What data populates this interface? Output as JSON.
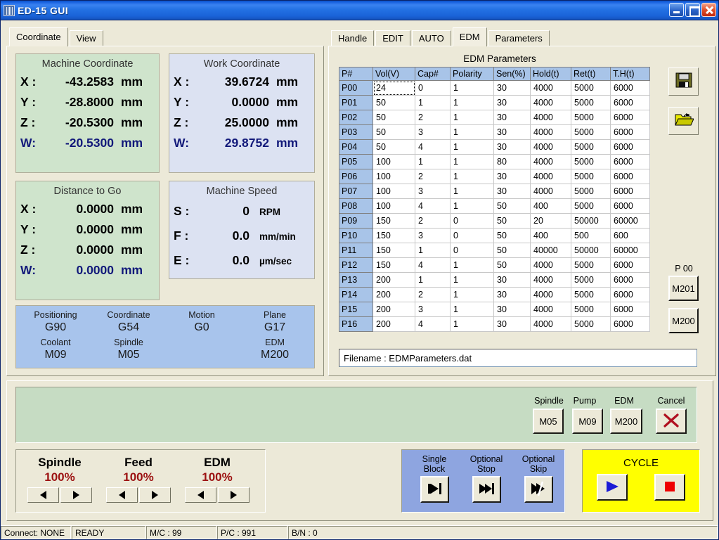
{
  "window": {
    "title": "ED-15 GUI",
    "minimize_label": "Minimize",
    "maximize_label": "Maximize",
    "close_label": "Close"
  },
  "left_tabs": [
    {
      "label": "Coordinate",
      "active": true
    },
    {
      "label": "View",
      "active": false
    }
  ],
  "machine_coordinate": {
    "caption": "Machine Coordinate",
    "rows": [
      {
        "axis": "X :",
        "value": "-43.2583",
        "unit": "mm"
      },
      {
        "axis": "Y :",
        "value": "-28.8000",
        "unit": "mm"
      },
      {
        "axis": "Z :",
        "value": "-20.5300",
        "unit": "mm"
      },
      {
        "axis": "W:",
        "value": "-20.5300",
        "unit": "mm"
      }
    ]
  },
  "work_coordinate": {
    "caption": "Work Coordinate",
    "rows": [
      {
        "axis": "X :",
        "value": "39.6724",
        "unit": "mm"
      },
      {
        "axis": "Y :",
        "value": "0.0000",
        "unit": "mm"
      },
      {
        "axis": "Z :",
        "value": "25.0000",
        "unit": "mm"
      },
      {
        "axis": "W:",
        "value": "29.8752",
        "unit": "mm"
      }
    ]
  },
  "distance_to_go": {
    "caption": "Distance to Go",
    "rows": [
      {
        "axis": "X :",
        "value": "0.0000",
        "unit": "mm"
      },
      {
        "axis": "Y :",
        "value": "0.0000",
        "unit": "mm"
      },
      {
        "axis": "Z :",
        "value": "0.0000",
        "unit": "mm"
      },
      {
        "axis": "W:",
        "value": "0.0000",
        "unit": "mm"
      }
    ]
  },
  "machine_speed": {
    "caption": "Machine Speed",
    "rows": [
      {
        "axis": "S :",
        "value": "0",
        "unit": "RPM"
      },
      {
        "axis": "F :",
        "value": "0.0",
        "unit": "mm/min"
      },
      {
        "axis": "E :",
        "value": "0.0",
        "unit": "µm/sec"
      }
    ]
  },
  "gcode_status": {
    "row1": [
      {
        "title": "Positioning",
        "value": "G90"
      },
      {
        "title": "Coordinate",
        "value": "G54"
      },
      {
        "title": "Motion",
        "value": "G0"
      },
      {
        "title": "Plane",
        "value": "G17"
      }
    ],
    "row2": [
      {
        "title": "Coolant",
        "value": "M09"
      },
      {
        "title": "Spindle",
        "value": "M05"
      },
      {
        "title": "",
        "value": ""
      },
      {
        "title": "EDM",
        "value": "M200"
      }
    ]
  },
  "right_tabs": [
    {
      "label": "Handle",
      "active": false
    },
    {
      "label": "EDIT",
      "active": false
    },
    {
      "label": "AUTO",
      "active": false
    },
    {
      "label": "EDM",
      "active": true
    },
    {
      "label": "Parameters",
      "active": false
    }
  ],
  "edm": {
    "title": "EDM Parameters",
    "columns": [
      "P#",
      "Vol(V)",
      "Cap#",
      "Polarity",
      "Sen(%)",
      "Hold(t)",
      "Ret(t)",
      "T.H(t)"
    ],
    "rows": [
      [
        "P00",
        "24",
        "0",
        "1",
        "30",
        "4000",
        "5000",
        "6000"
      ],
      [
        "P01",
        "50",
        "1",
        "1",
        "30",
        "4000",
        "5000",
        "6000"
      ],
      [
        "P02",
        "50",
        "2",
        "1",
        "30",
        "4000",
        "5000",
        "6000"
      ],
      [
        "P03",
        "50",
        "3",
        "1",
        "30",
        "4000",
        "5000",
        "6000"
      ],
      [
        "P04",
        "50",
        "4",
        "1",
        "30",
        "4000",
        "5000",
        "6000"
      ],
      [
        "P05",
        "100",
        "1",
        "1",
        "80",
        "4000",
        "5000",
        "6000"
      ],
      [
        "P06",
        "100",
        "2",
        "1",
        "30",
        "4000",
        "5000",
        "6000"
      ],
      [
        "P07",
        "100",
        "3",
        "1",
        "30",
        "4000",
        "5000",
        "6000"
      ],
      [
        "P08",
        "100",
        "4",
        "1",
        "50",
        "400",
        "5000",
        "6000"
      ],
      [
        "P09",
        "150",
        "2",
        "0",
        "50",
        "20",
        "50000",
        "60000"
      ],
      [
        "P10",
        "150",
        "3",
        "0",
        "50",
        "400",
        "500",
        "600"
      ],
      [
        "P11",
        "150",
        "1",
        "0",
        "50",
        "40000",
        "50000",
        "60000"
      ],
      [
        "P12",
        "150",
        "4",
        "1",
        "50",
        "4000",
        "5000",
        "6000"
      ],
      [
        "P13",
        "200",
        "1",
        "1",
        "30",
        "4000",
        "5000",
        "6000"
      ],
      [
        "P14",
        "200",
        "2",
        "1",
        "30",
        "4000",
        "5000",
        "6000"
      ],
      [
        "P15",
        "200",
        "3",
        "1",
        "30",
        "4000",
        "5000",
        "6000"
      ],
      [
        "P16",
        "200",
        "4",
        "1",
        "30",
        "4000",
        "5000",
        "6000"
      ]
    ],
    "focused_cell": {
      "row": 0,
      "col": 1
    },
    "filename_label": "Filename : EDMParameters.dat",
    "save_icon": "floppy-disk-icon",
    "open_icon": "open-folder-icon",
    "program_label": "P 00",
    "m201_label": "M201",
    "m200_label": "M200"
  },
  "mcodes": [
    {
      "title": "Spindle",
      "value": "M05"
    },
    {
      "title": "Pump",
      "value": "M09"
    },
    {
      "title": "EDM",
      "value": "M200"
    },
    {
      "title": "Cancel",
      "value": ""
    }
  ],
  "overrides": [
    {
      "name": "Spindle",
      "pct": "100%"
    },
    {
      "name": "Feed",
      "pct": "100%"
    },
    {
      "name": "EDM",
      "pct": "100%"
    }
  ],
  "modes": [
    {
      "l1": "Single",
      "l2": "Block",
      "icon": "single-block-icon"
    },
    {
      "l1": "Optional",
      "l2": "Stop",
      "icon": "optional-stop-icon"
    },
    {
      "l1": "Optional",
      "l2": "Skip",
      "icon": "optional-skip-icon"
    }
  ],
  "cycle": {
    "title": "CYCLE",
    "start_icon": "play-triangle-icon",
    "stop_icon": "stop-square-icon"
  },
  "statusbar": [
    "Connect: NONE",
    "READY",
    "M/C : 99",
    "P/C : 991",
    "B/N : 0"
  ],
  "colors": {
    "titlebar_blue": "#1a63e0",
    "green_panel": "#cfe4cc",
    "blue_panel": "#dce2f2",
    "gstatus_blue": "#a8c4ec",
    "override_red": "#9c1111",
    "cycle_yellow": "#ffff00",
    "mode_blue": "#8ea5e0",
    "table_header_blue": "#a8c4e8"
  }
}
